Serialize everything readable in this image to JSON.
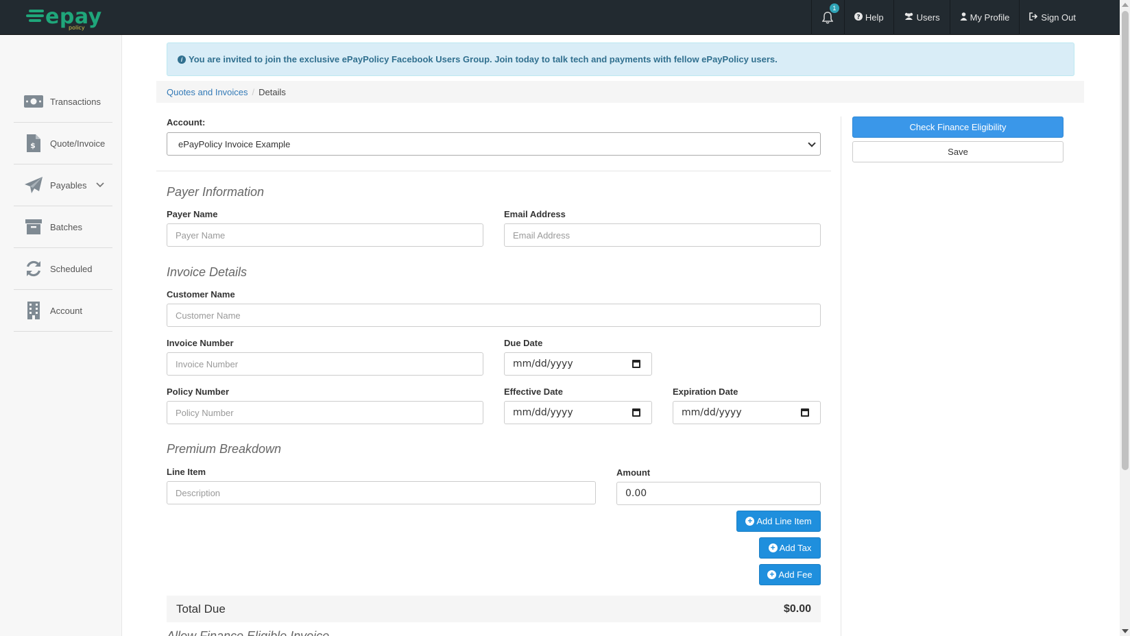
{
  "topbar": {
    "logo_text": "epay",
    "logo_sub": "policy",
    "notification_count": "1",
    "help": "Help",
    "users": "Users",
    "profile": "My Profile",
    "signout": "Sign Out"
  },
  "sidebar": {
    "items": [
      {
        "label": "Transactions",
        "icon": "money-icon"
      },
      {
        "label": "Quote/Invoice",
        "icon": "invoice-icon"
      },
      {
        "label": "Payables",
        "icon": "paper-plane-icon"
      },
      {
        "label": "Batches",
        "icon": "archive-icon"
      },
      {
        "label": "Scheduled",
        "icon": "refresh-icon"
      },
      {
        "label": "Account",
        "icon": "building-icon"
      }
    ]
  },
  "alert": {
    "text": "You are invited to join the exclusive ePayPolicy Facebook Users Group. Join today to talk tech and payments with fellow ePayPolicy users."
  },
  "breadcrumb": {
    "parent": "Quotes and Invoices",
    "separator": "/",
    "current": "Details"
  },
  "account": {
    "label": "Account:",
    "selected": "ePayPolicy Invoice Example"
  },
  "actions": {
    "finance": "Check Finance Eligibility",
    "save": "Save"
  },
  "payer": {
    "title": "Payer Information",
    "name_label": "Payer Name",
    "name_placeholder": "Payer Name",
    "email_label": "Email Address",
    "email_placeholder": "Email Address"
  },
  "invoice": {
    "title": "Invoice Details",
    "customer_label": "Customer Name",
    "customer_placeholder": "Customer Name",
    "number_label": "Invoice Number",
    "number_placeholder": "Invoice Number",
    "due_label": "Due Date",
    "due_value": "mm/dd/yyyy",
    "policy_label": "Policy Number",
    "policy_placeholder": "Policy Number",
    "effective_label": "Effective Date",
    "effective_value": "mm/dd/yyyy",
    "expiration_label": "Expiration Date",
    "expiration_value": "mm/dd/yyyy"
  },
  "premium": {
    "title": "Premium Breakdown",
    "line_label": "Line Item",
    "line_placeholder": "Description",
    "amount_label": "Amount",
    "amount_value": "0.00",
    "add_line": "Add Line Item",
    "add_tax": "Add Tax",
    "add_fee": "Add Fee"
  },
  "total": {
    "label": "Total Due",
    "amount": "$0.00"
  },
  "cutoff": {
    "text": "Allow Finance Eligible Invoice"
  },
  "colors": {
    "topbar": "#222a30",
    "brand": "#1fa67a",
    "primary": "#3a97e9",
    "alert_bg": "#d9edf7"
  }
}
